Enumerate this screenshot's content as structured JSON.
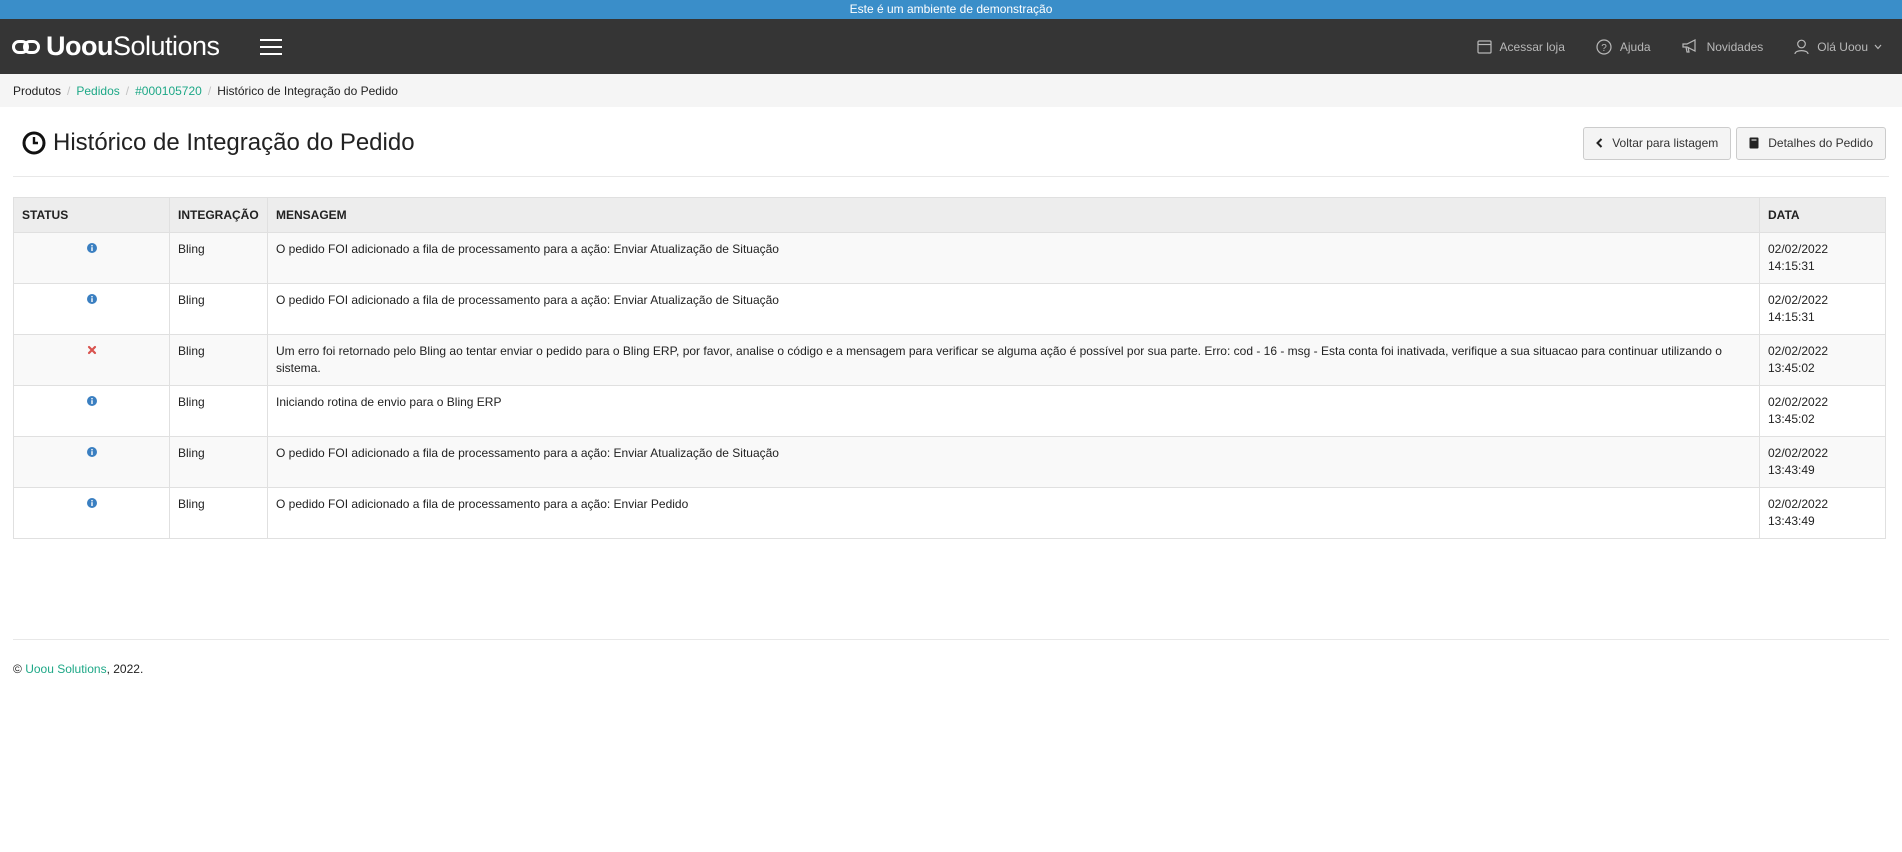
{
  "banner": {
    "text": "Este é um ambiente de demonstração"
  },
  "logo": {
    "bold": "Uoou",
    "light": "Solutions"
  },
  "top_nav": [
    {
      "icon": "store-icon",
      "label": "Acessar loja"
    },
    {
      "icon": "help-icon",
      "label": "Ajuda"
    },
    {
      "icon": "megaphone-icon",
      "label": "Novidades"
    },
    {
      "icon": "user-icon",
      "label": "Olá Uoou"
    }
  ],
  "breadcrumb": {
    "items": [
      "Produtos",
      "Pedidos",
      "#000105720"
    ],
    "current": "Histórico de Integração do Pedido"
  },
  "page": {
    "title": "Histórico de Integração do Pedido",
    "back_button": "Voltar para listagem",
    "details_button": "Detalhes do Pedido"
  },
  "table": {
    "headers": [
      "STATUS",
      "INTEGRAÇÃO",
      "MENSAGEM",
      "DATA"
    ],
    "rows": [
      {
        "status": "info",
        "integration": "Bling",
        "message": "O pedido FOI adicionado a fila de processamento para a ação: Enviar Atualização de Situação",
        "date": "02/02/2022",
        "time": "14:15:31"
      },
      {
        "status": "info",
        "integration": "Bling",
        "message": "O pedido FOI adicionado a fila de processamento para a ação: Enviar Atualização de Situação",
        "date": "02/02/2022",
        "time": "14:15:31"
      },
      {
        "status": "error",
        "integration": "Bling",
        "message": "Um erro foi retornado pelo Bling ao tentar enviar o pedido para o Bling ERP, por favor, analise o código e a mensagem para verificar se alguma ação é possível por sua parte. Erro: cod - 16 - msg - Esta conta foi inativada, verifique a sua situacao para continuar utilizando o sistema.",
        "date": "02/02/2022",
        "time": "13:45:02"
      },
      {
        "status": "info",
        "integration": "Bling",
        "message": "Iniciando rotina de envio para o Bling ERP",
        "date": "02/02/2022",
        "time": "13:45:02"
      },
      {
        "status": "info",
        "integration": "Bling",
        "message": "O pedido FOI adicionado a fila de processamento para a ação: Enviar Atualização de Situação",
        "date": "02/02/2022",
        "time": "13:43:49"
      },
      {
        "status": "info",
        "integration": "Bling",
        "message": "O pedido FOI adicionado a fila de processamento para a ação: Enviar Pedido",
        "date": "02/02/2022",
        "time": "13:43:49"
      }
    ]
  },
  "footer": {
    "prefix": "© ",
    "link": "Uoou Solutions",
    "suffix": ", 2022."
  },
  "colors": {
    "banner": "#3a8ec9",
    "topbar": "#353535",
    "link": "#1ea887",
    "info": "#3a7fc1",
    "error": "#d9534f"
  }
}
